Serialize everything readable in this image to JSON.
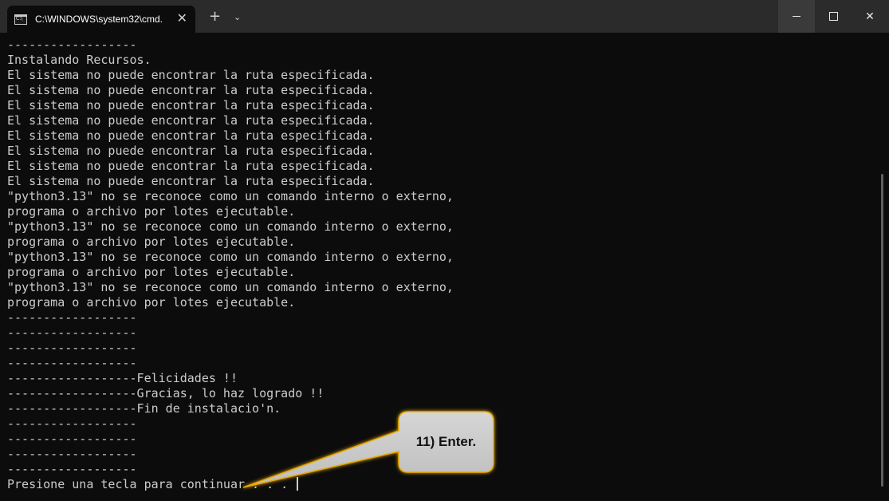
{
  "window": {
    "tab_title": "C:\\WINDOWS\\system32\\cmd.",
    "tab_close": "✕",
    "new_tab": "+",
    "dropdown": "⌄",
    "close_glyph": "✕"
  },
  "terminal": {
    "lines": [
      "------------------",
      "Instalando Recursos.",
      "El sistema no puede encontrar la ruta especificada.",
      "El sistema no puede encontrar la ruta especificada.",
      "El sistema no puede encontrar la ruta especificada.",
      "El sistema no puede encontrar la ruta especificada.",
      "El sistema no puede encontrar la ruta especificada.",
      "El sistema no puede encontrar la ruta especificada.",
      "El sistema no puede encontrar la ruta especificada.",
      "El sistema no puede encontrar la ruta especificada.",
      "\"python3.13\" no se reconoce como un comando interno o externo,",
      "programa o archivo por lotes ejecutable.",
      "\"python3.13\" no se reconoce como un comando interno o externo,",
      "programa o archivo por lotes ejecutable.",
      "\"python3.13\" no se reconoce como un comando interno o externo,",
      "programa o archivo por lotes ejecutable.",
      "\"python3.13\" no se reconoce como un comando interno o externo,",
      "programa o archivo por lotes ejecutable.",
      "------------------",
      "------------------",
      "------------------",
      "------------------",
      "------------------Felicidades !!",
      "------------------Gracias, lo haz logrado !!",
      "------------------Fin de instalacio'n.",
      "------------------",
      "------------------",
      "------------------",
      "------------------",
      "Presione una tecla para continuar . . . "
    ]
  },
  "annotation": {
    "callout_text": "11) Enter."
  },
  "colors": {
    "terminal_bg": "#0c0c0c",
    "terminal_text": "#cccccc",
    "titlebar_bg": "#2b2b2b",
    "callout_fill": "#c8c8c8",
    "callout_glow": "#e8a800"
  }
}
